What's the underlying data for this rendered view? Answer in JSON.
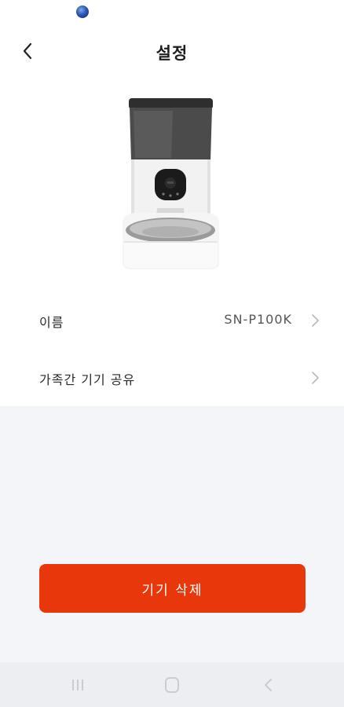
{
  "header": {
    "title": "설정",
    "back_icon": "chevron-left-icon"
  },
  "device": {
    "image": "automatic-pet-feeder-photo"
  },
  "settings": {
    "name_label": "이름",
    "name_value": "SN-P100K",
    "share_label": "가족간 기기 공유",
    "chevron_icon": "chevron-right-icon"
  },
  "actions": {
    "delete_label": "기기 삭제"
  },
  "colors": {
    "accent": "#e8380b",
    "lower_background": "#f4f5f8"
  },
  "system_nav": {
    "icons": [
      "recents-icon",
      "home-icon",
      "back-icon"
    ]
  }
}
